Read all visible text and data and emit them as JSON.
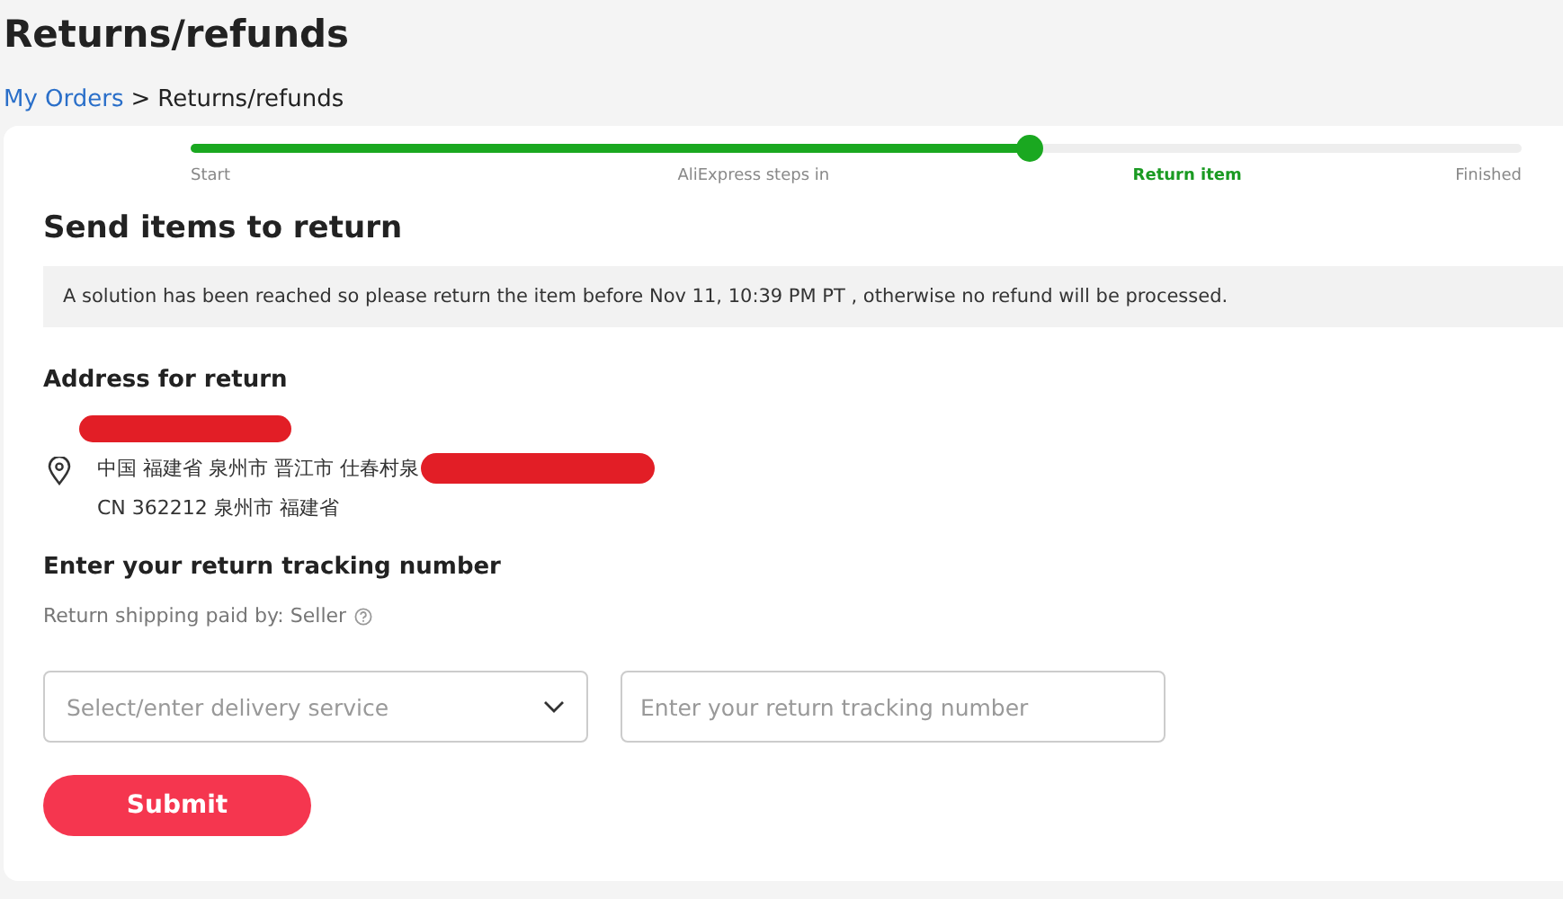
{
  "page": {
    "title": "Returns/refunds"
  },
  "breadcrumb": [
    {
      "label": "My Orders",
      "kind": "link"
    },
    {
      "label": ">",
      "kind": "separator"
    },
    {
      "label": "Returns/refunds",
      "kind": "current"
    }
  ],
  "progress": {
    "level": 0.63,
    "steps": [
      {
        "label": "Start",
        "selected": false
      },
      {
        "label": "AliExpress steps in",
        "selected": false
      },
      {
        "label": "Return item",
        "selected": true
      },
      {
        "label": "Finished",
        "selected": false
      }
    ]
  },
  "section_title": "Send items to return",
  "notice": "A solution has been reached so please return the item before Nov 11, 10:39 PM PT , otherwise no refund will be processed.",
  "address": {
    "heading": "Address for return",
    "lines": [
      "中国 福建省 泉州市 晋江市 仕春村泉",
      "CN 362212 泉州市 福建省"
    ]
  },
  "tracking": {
    "heading": "Enter your return tracking number",
    "paid_by": "Return shipping paid by: Seller",
    "delivery_field": {
      "placeholder": "Select/enter delivery service"
    },
    "number_field": {
      "placeholder": "Enter your return tracking number"
    },
    "submit": "Submit"
  }
}
